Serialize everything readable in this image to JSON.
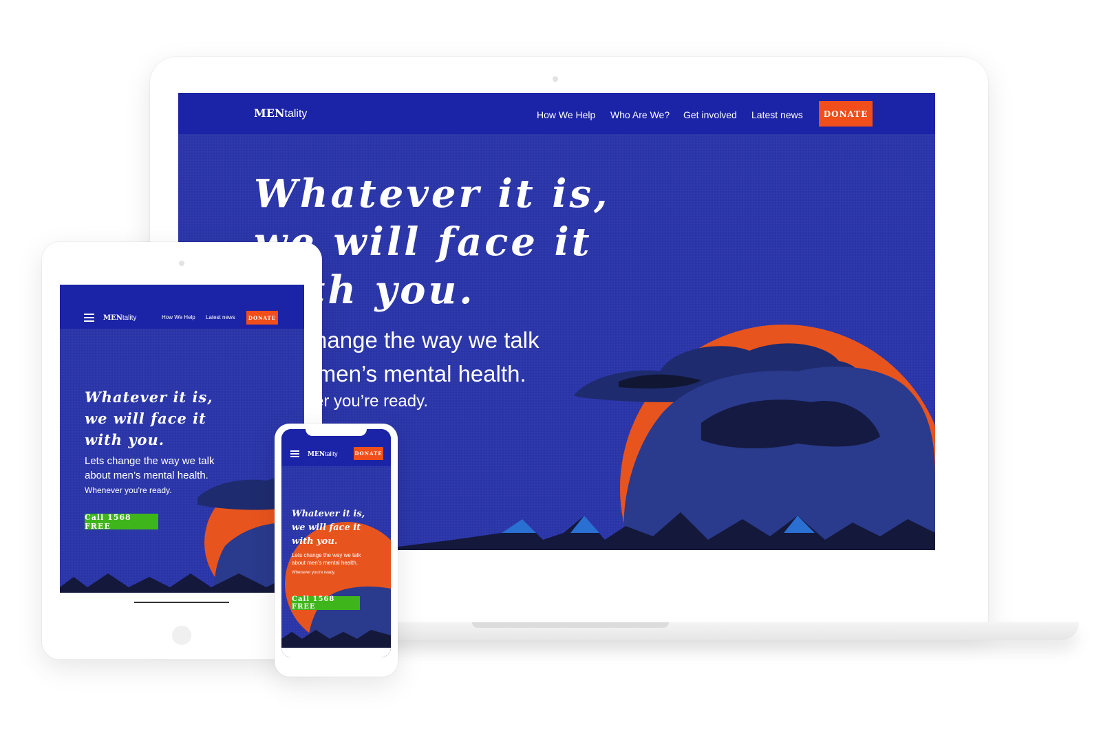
{
  "brand": {
    "logo_bold": "MEN",
    "logo_rest": "tality"
  },
  "nav": {
    "links": [
      "How We Help",
      "Who Are We?",
      "Get involved",
      "Latest news"
    ],
    "donate_label": "DONATE"
  },
  "hero": {
    "headline_1": "Whatever it is,",
    "headline_2": "we will face it",
    "headline_3": "with you.",
    "subtitle_1": "Lets change the way we talk",
    "subtitle_2": "about men’s mental health.",
    "tagline": "Whenever you’re ready.",
    "cta_label": "Call 1568 FREE"
  },
  "colors": {
    "brand_blue": "#1b23a6",
    "hero_blue": "#2a35a8",
    "sun_orange": "#e8541d",
    "donate_orange": "#f04e1a",
    "cta_green": "#3fb51c"
  },
  "icons": [
    "menu-icon",
    "camera-dot",
    "home-button"
  ]
}
